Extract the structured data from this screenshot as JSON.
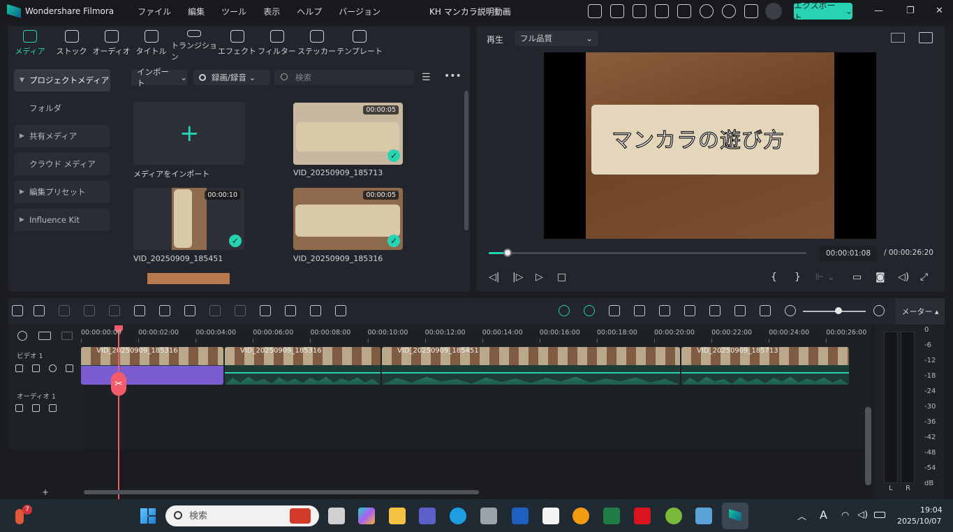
{
  "app": {
    "name": "Wondershare Filmora",
    "document_title": "KH マンカラ説明動画"
  },
  "menu": [
    "ファイル",
    "編集",
    "ツール",
    "表示",
    "ヘルプ",
    "バージョン"
  ],
  "header": {
    "export_label": "エクスポート"
  },
  "toolbar_tabs": [
    {
      "label": "メディア",
      "icon": "media-icon"
    },
    {
      "label": "ストック",
      "icon": "stock-icon"
    },
    {
      "label": "オーディオ",
      "icon": "audio-icon"
    },
    {
      "label": "タイトル",
      "icon": "title-icon"
    },
    {
      "label": "トランジション",
      "icon": "transition-icon"
    },
    {
      "label": "エフェクト",
      "icon": "effect-icon"
    },
    {
      "label": "フィルター",
      "icon": "filter-icon"
    },
    {
      "label": "ステッカー",
      "icon": "sticker-icon"
    },
    {
      "label": "テンプレート",
      "icon": "template-icon"
    }
  ],
  "sidebar": {
    "items": [
      {
        "label": "プロジェクトメディア"
      },
      {
        "label": "フォルダ"
      },
      {
        "label": "共有メディア"
      },
      {
        "label": "クラウド メディア"
      },
      {
        "label": "編集プリセット"
      },
      {
        "label": "Influence Kit"
      }
    ]
  },
  "media": {
    "import_label": "インポート",
    "record_label": "録画/録音",
    "search_placeholder": "検索",
    "import_tile_label": "メディアをインポート",
    "items": [
      {
        "name": "VID_20250909_185713",
        "duration": "00:00:05"
      },
      {
        "name": "VID_20250909_185451",
        "duration": "00:00:10"
      },
      {
        "name": "VID_20250909_185316",
        "duration": "00:00:05"
      }
    ]
  },
  "preview": {
    "play_label": "再生",
    "quality": "フル品質",
    "overlay_title": "マンカラの遊び方",
    "current_time": "00:00:01:08",
    "total_time": "/  00:00:26:20",
    "progress": 0.06
  },
  "timeline": {
    "meter_label": "メーター",
    "ruler": [
      "00:00:00:00",
      "00:00:02:00",
      "00:00:04:00",
      "00:00:06:00",
      "00:00:08:00",
      "00:00:10:00",
      "00:00:12:00",
      "00:00:14:00",
      "00:00:16:00",
      "00:00:18:00",
      "00:00:20:00",
      "00:00:22:00",
      "00:00:24:00",
      "00:00:26:00"
    ],
    "tracks": {
      "video": "ビデオ 1",
      "audio": "オーディオ 1"
    },
    "clips": [
      {
        "name": "VID_20250909_185316"
      },
      {
        "name": "VID_20250909_185316"
      },
      {
        "name": "VID_20250909_185451"
      },
      {
        "name": "VID_20250909_185713"
      }
    ],
    "db_scale": [
      "0",
      "-6",
      "-12",
      "-18",
      "-24",
      "-30",
      "-36",
      "-42",
      "-48",
      "-54",
      "dB"
    ],
    "meter_channels": [
      "L",
      "R"
    ]
  },
  "taskbar": {
    "notification_badge": "7",
    "search_placeholder": "検索",
    "ime_label": "A",
    "time": "19:04",
    "date": "2025/10/07"
  },
  "colors": {
    "accent": "#27d3b3",
    "playhead": "#f25c6a",
    "audio_clip": "#7a5bd0"
  }
}
